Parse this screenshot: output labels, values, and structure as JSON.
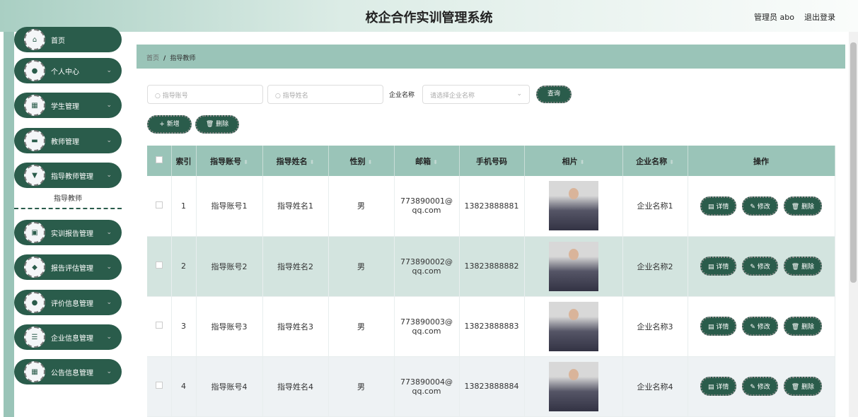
{
  "header": {
    "title": "校企合作实训管理系统",
    "user": "管理员 abo",
    "logout": "退出登录"
  },
  "sidebar": {
    "items": [
      {
        "label": "首页",
        "icon": "home-icon",
        "glyph": "⌂"
      },
      {
        "label": "个人中心",
        "icon": "user-icon",
        "glyph": "●"
      },
      {
        "label": "学生管理",
        "icon": "grid-icon",
        "glyph": "▦"
      },
      {
        "label": "教师管理",
        "icon": "briefcase-icon",
        "glyph": "▬"
      },
      {
        "label": "指导教师管理",
        "icon": "brush-icon",
        "glyph": "▼"
      },
      {
        "label": "实训报告管理",
        "icon": "report-icon",
        "glyph": "▣"
      },
      {
        "label": "报告评估管理",
        "icon": "location-icon",
        "glyph": "◆"
      },
      {
        "label": "评价信息管理",
        "icon": "user-icon",
        "glyph": "●"
      },
      {
        "label": "企业信息管理",
        "icon": "sliders-icon",
        "glyph": "☰"
      },
      {
        "label": "公告信息管理",
        "icon": "grid-icon",
        "glyph": "▦"
      }
    ],
    "sub": "指导教师"
  },
  "breadcrumb": {
    "home": "首页",
    "sep": "/",
    "current": "指导教师"
  },
  "search": {
    "account_ph": "指导账号",
    "name_ph": "指导姓名",
    "company_label": "企业名称",
    "company_ph": "请选择企业名称",
    "query": "查询"
  },
  "actions": {
    "add": "+ 新增",
    "delete": "🗑 删除"
  },
  "table": {
    "headers": [
      "索引",
      "指导账号",
      "指导姓名",
      "性别",
      "邮箱",
      "手机号码",
      "相片",
      "企业名称",
      "操作"
    ],
    "ops": {
      "detail": "▤ 详情",
      "edit": "✎ 修改",
      "delete": "🗑 删除"
    },
    "rows": [
      {
        "idx": "1",
        "account": "指导账号1",
        "name": "指导姓名1",
        "gender": "男",
        "email": "773890001@qq.com",
        "phone": "13823888881",
        "company": "企业名称1"
      },
      {
        "idx": "2",
        "account": "指导账号2",
        "name": "指导姓名2",
        "gender": "男",
        "email": "773890002@qq.com",
        "phone": "13823888882",
        "company": "企业名称2"
      },
      {
        "idx": "3",
        "account": "指导账号3",
        "name": "指导姓名3",
        "gender": "男",
        "email": "773890003@qq.com",
        "phone": "13823888883",
        "company": "企业名称3"
      },
      {
        "idx": "4",
        "account": "指导账号4",
        "name": "指导姓名4",
        "gender": "男",
        "email": "773890004@qq.com",
        "phone": "13823888884",
        "company": "企业名称4"
      }
    ]
  },
  "colors": {
    "primary": "#2a5c4b",
    "header": "#9ac4b8"
  }
}
